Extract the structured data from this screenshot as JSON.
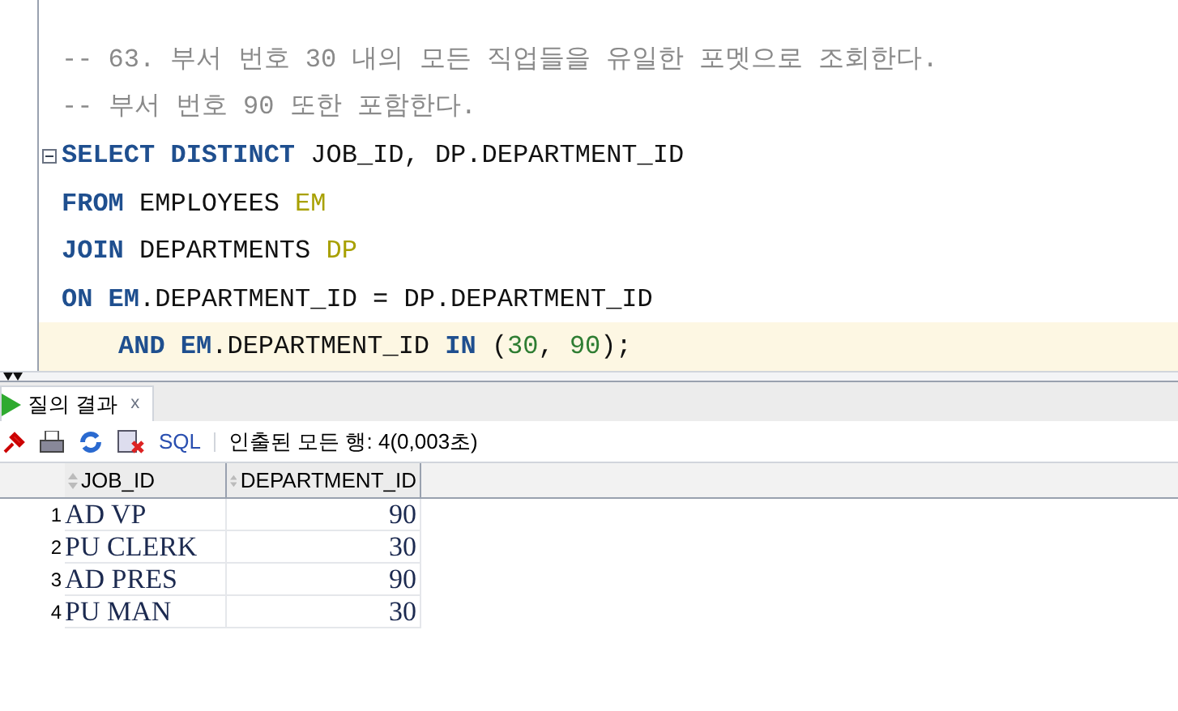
{
  "editor": {
    "lines": [
      {
        "current": false,
        "tokens": [
          {
            "kind": "comment",
            "text": "-- 63. 부서 번호 30 내의 모든 직업들을 유일한 포멧으로 조회한다."
          }
        ]
      },
      {
        "current": false,
        "tokens": [
          {
            "kind": "comment",
            "text": "-- 부서 번호 90 또한 포함한다."
          }
        ]
      },
      {
        "current": false,
        "foldable": true,
        "tokens": [
          {
            "kind": "keyword",
            "text": "SELECT DISTINCT"
          },
          {
            "kind": "plain",
            "text": " JOB_ID, DP.DEPARTMENT_ID"
          }
        ]
      },
      {
        "current": false,
        "tokens": [
          {
            "kind": "keyword",
            "text": "FROM"
          },
          {
            "kind": "plain",
            "text": " EMPLOYEES "
          },
          {
            "kind": "alias",
            "text": "EM"
          }
        ]
      },
      {
        "current": false,
        "tokens": [
          {
            "kind": "keyword",
            "text": "JOIN"
          },
          {
            "kind": "plain",
            "text": " DEPARTMENTS "
          },
          {
            "kind": "alias",
            "text": "DP"
          }
        ]
      },
      {
        "current": false,
        "tokens": [
          {
            "kind": "keyword",
            "text": "ON EM"
          },
          {
            "kind": "plain",
            "text": ".DEPARTMENT_ID = DP.DEPARTMENT_ID"
          }
        ]
      },
      {
        "current": true,
        "indented": true,
        "tokens": [
          {
            "kind": "keyword",
            "text": "AND EM"
          },
          {
            "kind": "plain",
            "text": ".DEPARTMENT_ID "
          },
          {
            "kind": "keyword",
            "text": "IN"
          },
          {
            "kind": "plain",
            "text": " ("
          },
          {
            "kind": "number",
            "text": "30"
          },
          {
            "kind": "plain",
            "text": ", "
          },
          {
            "kind": "number",
            "text": "90"
          },
          {
            "kind": "plain",
            "text": ");"
          }
        ]
      }
    ]
  },
  "results_tab": {
    "label": "질의 결과",
    "close": "x",
    "selected": true
  },
  "toolbar": {
    "sql": "SQL",
    "status": "인출된 모든 행: 4(0,003초)"
  },
  "table": {
    "columns": [
      "JOB_ID",
      "DEPARTMENT_ID"
    ],
    "rows": [
      {
        "number": "1",
        "cells": [
          "AD VP",
          "90"
        ]
      },
      {
        "number": "2",
        "cells": [
          "PU CLERK",
          "30"
        ]
      },
      {
        "number": "3",
        "cells": [
          "AD PRES",
          "90"
        ]
      },
      {
        "number": "4",
        "cells": [
          "PU MAN",
          "30"
        ]
      }
    ]
  }
}
